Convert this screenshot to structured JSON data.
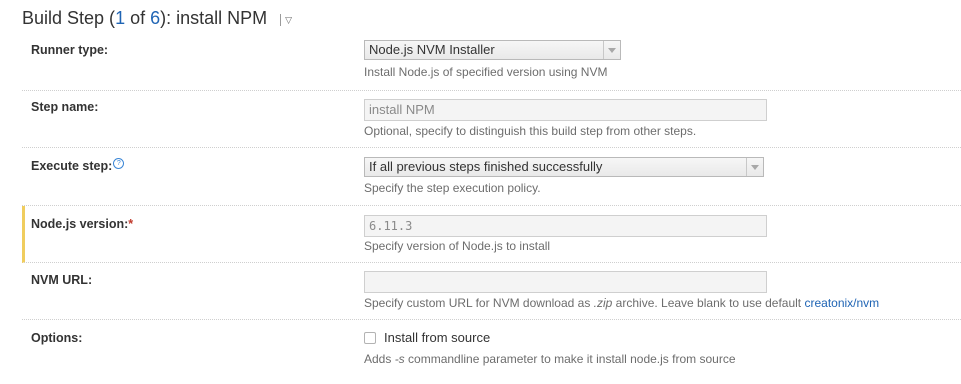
{
  "header": {
    "prefix": "Build Step (",
    "step_index": "1",
    "of_text": " of ",
    "step_total": "6",
    "suffix": "): install NPM",
    "menu_icon": "chevron-down-icon"
  },
  "rows": {
    "runner_type": {
      "label": "Runner type:",
      "value": "Node.js NVM Installer",
      "hint": "Install Node.js of specified version using NVM"
    },
    "step_name": {
      "label": "Step name:",
      "value": "install NPM",
      "hint": "Optional, specify to distinguish this build step from other steps."
    },
    "execute_step": {
      "label": "Execute step:",
      "help_icon": "?",
      "value": "If all previous steps finished successfully",
      "hint": "Specify the step execution policy."
    },
    "nodejs_version": {
      "label": "Node.js version:",
      "required": "*",
      "value": "6.11.3",
      "hint": "Specify version of Node.js to install"
    },
    "nvm_url": {
      "label": "NVM URL:",
      "value": "",
      "hint_part1": "Specify custom URL for NVM download as ",
      "hint_em": ".zip",
      "hint_part2": " archive. Leave blank to use default ",
      "hint_link": "creatonix/nvm"
    },
    "options": {
      "label": "Options:",
      "checkbox_label": "Install from source",
      "checked": false,
      "hint_part1": "Adds ",
      "hint_em": "-s",
      "hint_part2": " commandline parameter to make it install node.js from source"
    }
  },
  "colors": {
    "accent_link": "#1f64b4",
    "highlight_bar": "#f0cd5e",
    "required": "#c0392b"
  }
}
